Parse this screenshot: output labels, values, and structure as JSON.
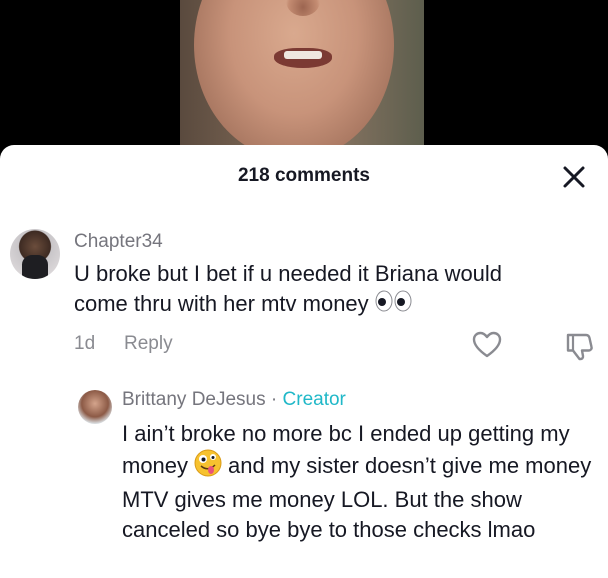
{
  "sheet": {
    "comment_count": "218 comments"
  },
  "comments": [
    {
      "username": "Chapter34",
      "text": "U broke but I bet if u needed it Briana would come thru with her mtv money",
      "emoji": "eyes",
      "age": "1d",
      "reply_label": "Reply"
    }
  ],
  "replies": [
    {
      "username": "Brittany DeJesus",
      "separator": "·",
      "badge": "Creator",
      "text_part1": "I ain’t broke no more bc I ended up getting my money",
      "emoji": "zany-face",
      "text_part2": "and my sister doesn’t give me money MTV gives me money LOL. But the show canceled so bye bye to those checks lmao"
    }
  ],
  "colors": {
    "creator_badge": "#20b8c8",
    "username": "#75757d",
    "text": "#161823"
  }
}
